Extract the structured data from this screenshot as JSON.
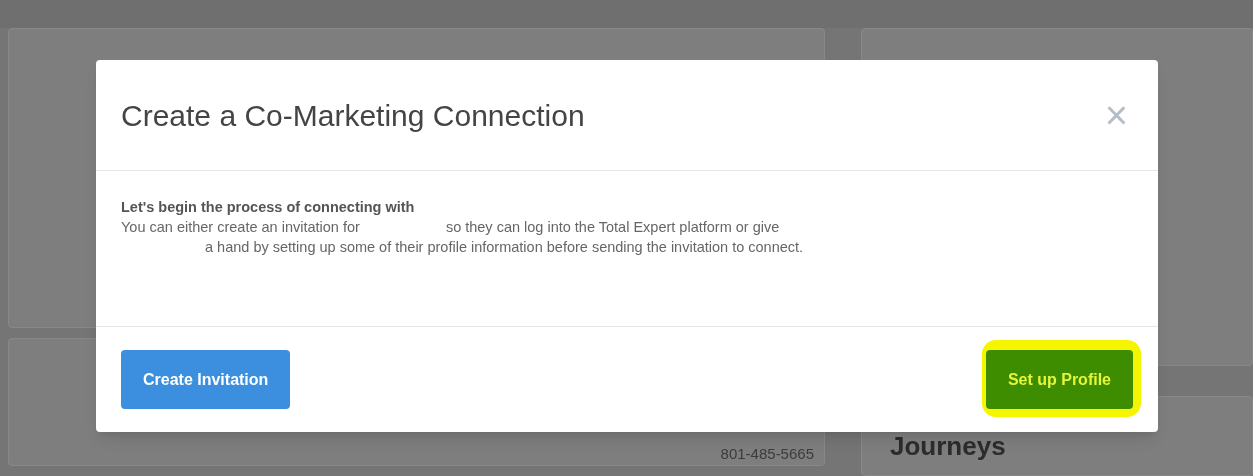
{
  "background": {
    "phone": "801-485-5665",
    "heading": "Journeys"
  },
  "modal": {
    "title": "Create a Co-Marketing Connection",
    "close": "×",
    "intro": "Let's begin the process of connecting with",
    "line_1_start": "You can either create an invitation for",
    "line_1_end": "so they can log into the Total Expert platform or give",
    "line_2": "a hand by setting up some of their profile information before sending the invitation to connect.",
    "buttons": [
      {
        "label": "Create Invitation",
        "kind": "primary",
        "highlighted": false
      },
      {
        "label": "Set up Profile",
        "kind": "success",
        "highlighted": true
      }
    ]
  }
}
